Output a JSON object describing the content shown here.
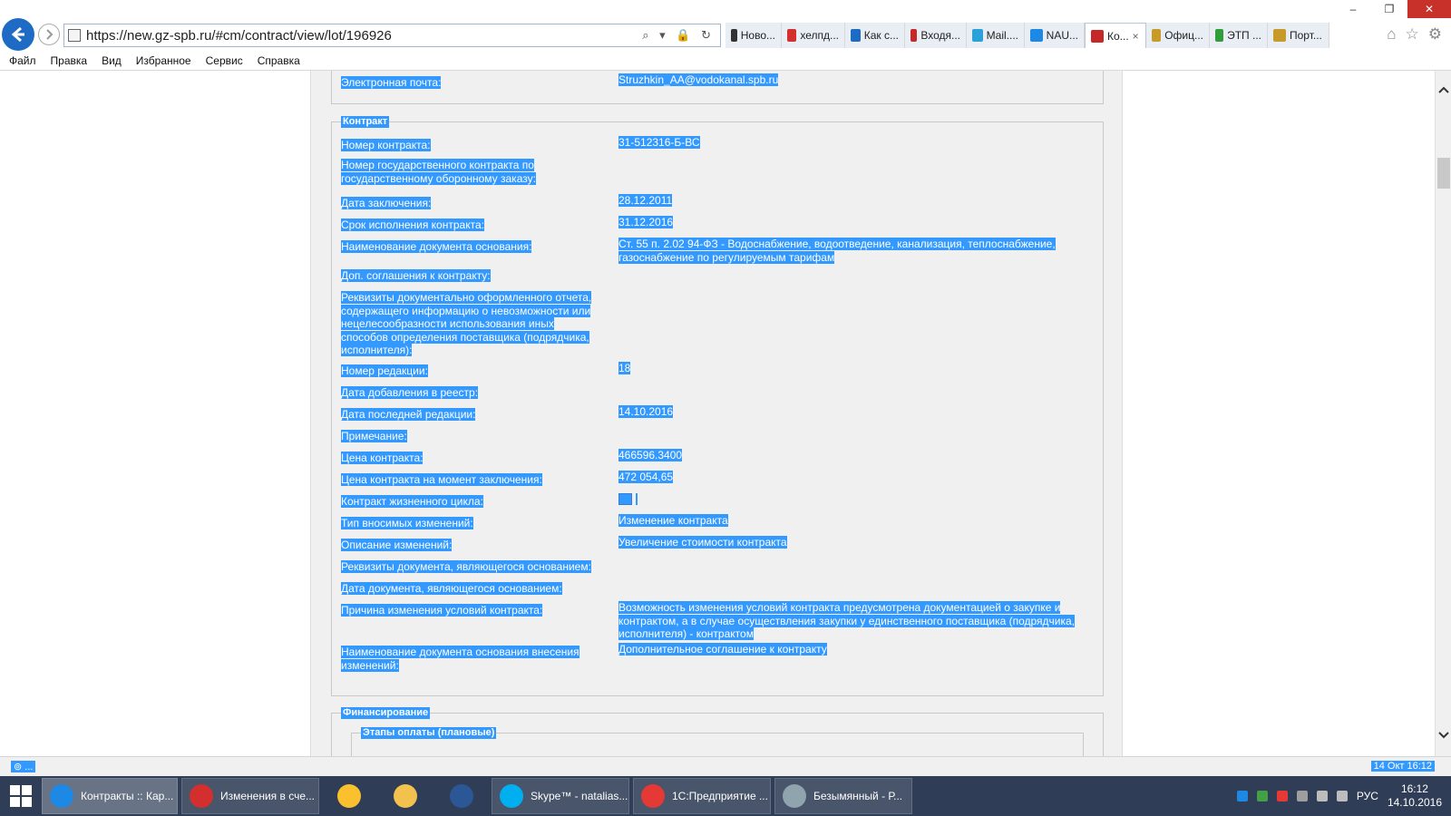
{
  "browser": {
    "url": "https://new.gz-spb.ru/#cm/contract/view/lot/196926",
    "url_tools": "⌕ ▾ 🔒 ↻",
    "tabs": [
      {
        "label": "Ново...",
        "color": "#333333"
      },
      {
        "label": "хелпд...",
        "color": "#d32f2f"
      },
      {
        "label": "Как с...",
        "color": "#1e6bc5"
      },
      {
        "label": "Входя...",
        "color": "#c62828"
      },
      {
        "label": "Mail....",
        "color": "#2aa1d9"
      },
      {
        "label": "NAU...",
        "color": "#1e88e5"
      },
      {
        "label": "Ко...",
        "color": "#c62828",
        "active": true,
        "close": "×"
      },
      {
        "label": "Офиц...",
        "color": "#c79a2a"
      },
      {
        "label": "ЭТП ...",
        "color": "#2e9d3a"
      },
      {
        "label": "Порт...",
        "color": "#c79a2a"
      }
    ],
    "window_controls": {
      "minimize": "–",
      "maximize": "❐",
      "close": "✕"
    },
    "right_icons": {
      "home": "⌂",
      "favorites": "☆",
      "settings": "⚙"
    }
  },
  "menu": [
    "Файл",
    "Правка",
    "Вид",
    "Избранное",
    "Сервис",
    "Справка"
  ],
  "content": {
    "email_label": "Электронная почта:",
    "email_value": "Struzhkin_AA@vodokanal.spb.ru",
    "contract_legend": "Контракт",
    "rows": [
      {
        "label": "Номер контракта:",
        "value": "31-512316-Б-ВС"
      },
      {
        "label": "Номер государственного контракта по государственному оборонному заказу:",
        "value": ""
      },
      {
        "label": "Дата заключения:",
        "value": "28.12.2011"
      },
      {
        "label": "Срок исполнения контракта:",
        "value": "31.12.2016"
      },
      {
        "label": "Наименование документа основания:",
        "value": "Ст. 55 п. 2.02 94-ФЗ - Водоснабжение, водоотведение, канализация, теплоснабжение, газоснабжение по регулируемым тарифам"
      },
      {
        "label": "Доп. соглашения к контракту:",
        "value": ""
      },
      {
        "label": "Реквизиты документально оформленного отчета, содержащего информацию о невозможности или нецелесообразности использования иных способов определения поставщика (подрядчика, исполнителя):",
        "value": ""
      },
      {
        "label": "Номер редакции:",
        "value": "18"
      },
      {
        "label": "Дата добавления в реестр:",
        "value": ""
      },
      {
        "label": "Дата последней редакции:",
        "value": "14.10.2016"
      },
      {
        "label": "Примечание:",
        "value": ""
      },
      {
        "label": "Цена контракта:",
        "value": "466596.3400"
      },
      {
        "label": "Цена контракта на момент заключения:",
        "value": "472 054,65"
      },
      {
        "label": "Контракт жизненного цикла:",
        "value": ""
      },
      {
        "label": "Тип вносимых изменений:",
        "value": "Изменение контракта"
      },
      {
        "label": "Описание изменений:",
        "value": "Увеличение стоимости контракта"
      },
      {
        "label": "Реквизиты документа, являющегося основанием:",
        "value": ""
      },
      {
        "label": "Дата документа, являющегося основанием:",
        "value": ""
      },
      {
        "label": "Причина изменения условий контракта:",
        "value": "Возможность изменения условий контракта предусмотрена документацией о закупке и контрактом, а в случае осуществления закупки у единственного поставщика (подрядчика, исполнителя) - контрактом"
      },
      {
        "label": "Наименование документа основания внесения изменений:",
        "value": "Дополнительное соглашение к контракту"
      }
    ],
    "finance_legend": "Финансирование",
    "stages_legend": "Этапы оплаты (плановые)"
  },
  "status": {
    "left": "⊚ ...",
    "right": "14 Окт 16:12"
  },
  "taskbar": {
    "items": [
      {
        "label": "Контракты :: Кар...",
        "color": "#1e88e5",
        "active": true
      },
      {
        "label": "Изменения в сче...",
        "color": "#d32f2f"
      },
      {
        "label": "",
        "color": "#fbc02d"
      },
      {
        "label": "",
        "color": "#f2c14e"
      },
      {
        "label": "",
        "color": "#2b5797"
      },
      {
        "label": "Skype™ - natalias...",
        "color": "#00aff0"
      },
      {
        "label": "1С:Предприятие ...",
        "color": "#e53935"
      },
      {
        "label": "Безымянный - Р...",
        "color": "#90a4ae"
      }
    ],
    "lang": "РУС",
    "time": "16:12",
    "date": "14.10.2016"
  }
}
